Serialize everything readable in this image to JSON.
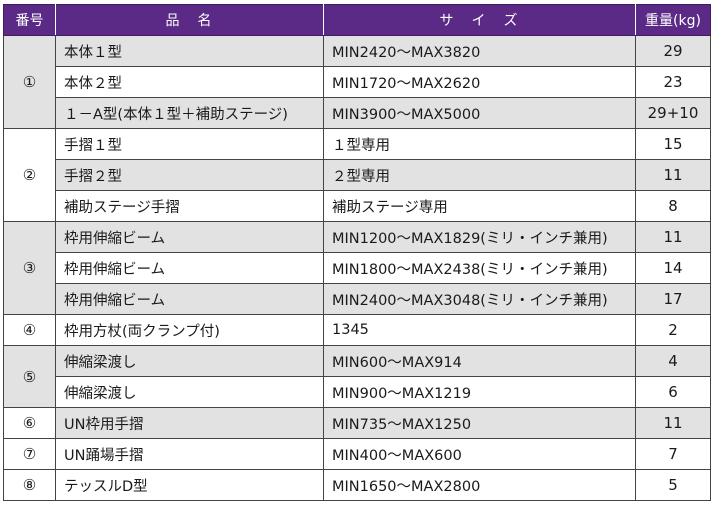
{
  "header": {
    "number": "番号",
    "name": "品　名",
    "size": "サ　イ　ズ",
    "weight": "重量(kg)"
  },
  "groups": [
    {
      "number": "①",
      "shaded": true,
      "rows": [
        {
          "name": "本体１型",
          "size": "MIN2420〜MAX3820",
          "weight": "29",
          "shaded": true
        },
        {
          "name": "本体２型",
          "size": "MIN1720〜MAX2620",
          "weight": "23",
          "shaded": false
        },
        {
          "name": "１－A型(本体１型＋補助ステージ)",
          "size": "MIN3900〜MAX5000",
          "weight": "29+10",
          "shaded": true
        }
      ]
    },
    {
      "number": "②",
      "shaded": false,
      "rows": [
        {
          "name": "手摺１型",
          "size": "１型専用",
          "weight": "15",
          "shaded": false
        },
        {
          "name": "手摺２型",
          "size": "２型専用",
          "weight": "11",
          "shaded": true
        },
        {
          "name": "補助ステージ手摺",
          "size": "補助ステージ専用",
          "weight": "8",
          "shaded": false
        }
      ]
    },
    {
      "number": "③",
      "shaded": true,
      "rows": [
        {
          "name": "枠用伸縮ビーム",
          "size": "MIN1200〜MAX1829(ミリ・インチ兼用)",
          "weight": "11",
          "shaded": true
        },
        {
          "name": "枠用伸縮ビーム",
          "size": "MIN1800〜MAX2438(ミリ・インチ兼用)",
          "weight": "14",
          "shaded": false
        },
        {
          "name": "枠用伸縮ビーム",
          "size": "MIN2400〜MAX3048(ミリ・インチ兼用)",
          "weight": "17",
          "shaded": true
        }
      ]
    },
    {
      "number": "④",
      "shaded": false,
      "rows": [
        {
          "name": "枠用方杖(両クランプ付)",
          "size": "1345",
          "weight": "2",
          "shaded": false
        }
      ]
    },
    {
      "number": "⑤",
      "shaded": true,
      "rows": [
        {
          "name": "伸縮梁渡し",
          "size": "MIN600〜MAX914",
          "weight": "4",
          "shaded": true
        },
        {
          "name": "伸縮梁渡し",
          "size": "MIN900〜MAX1219",
          "weight": "6",
          "shaded": false
        }
      ]
    },
    {
      "number": "⑥",
      "shaded": false,
      "rows": [
        {
          "name": "UN枠用手摺",
          "size": "MIN735〜MAX1250",
          "weight": "11",
          "shaded": true
        }
      ]
    },
    {
      "number": "⑦",
      "shaded": false,
      "rows": [
        {
          "name": "UN踊場手摺",
          "size": "MIN400〜MAX600",
          "weight": "7",
          "shaded": false
        }
      ]
    },
    {
      "number": "⑧",
      "shaded": false,
      "rows": [
        {
          "name": "テッスルD型",
          "size": "MIN1650〜MAX2800",
          "weight": "5",
          "shaded": false
        }
      ]
    }
  ]
}
